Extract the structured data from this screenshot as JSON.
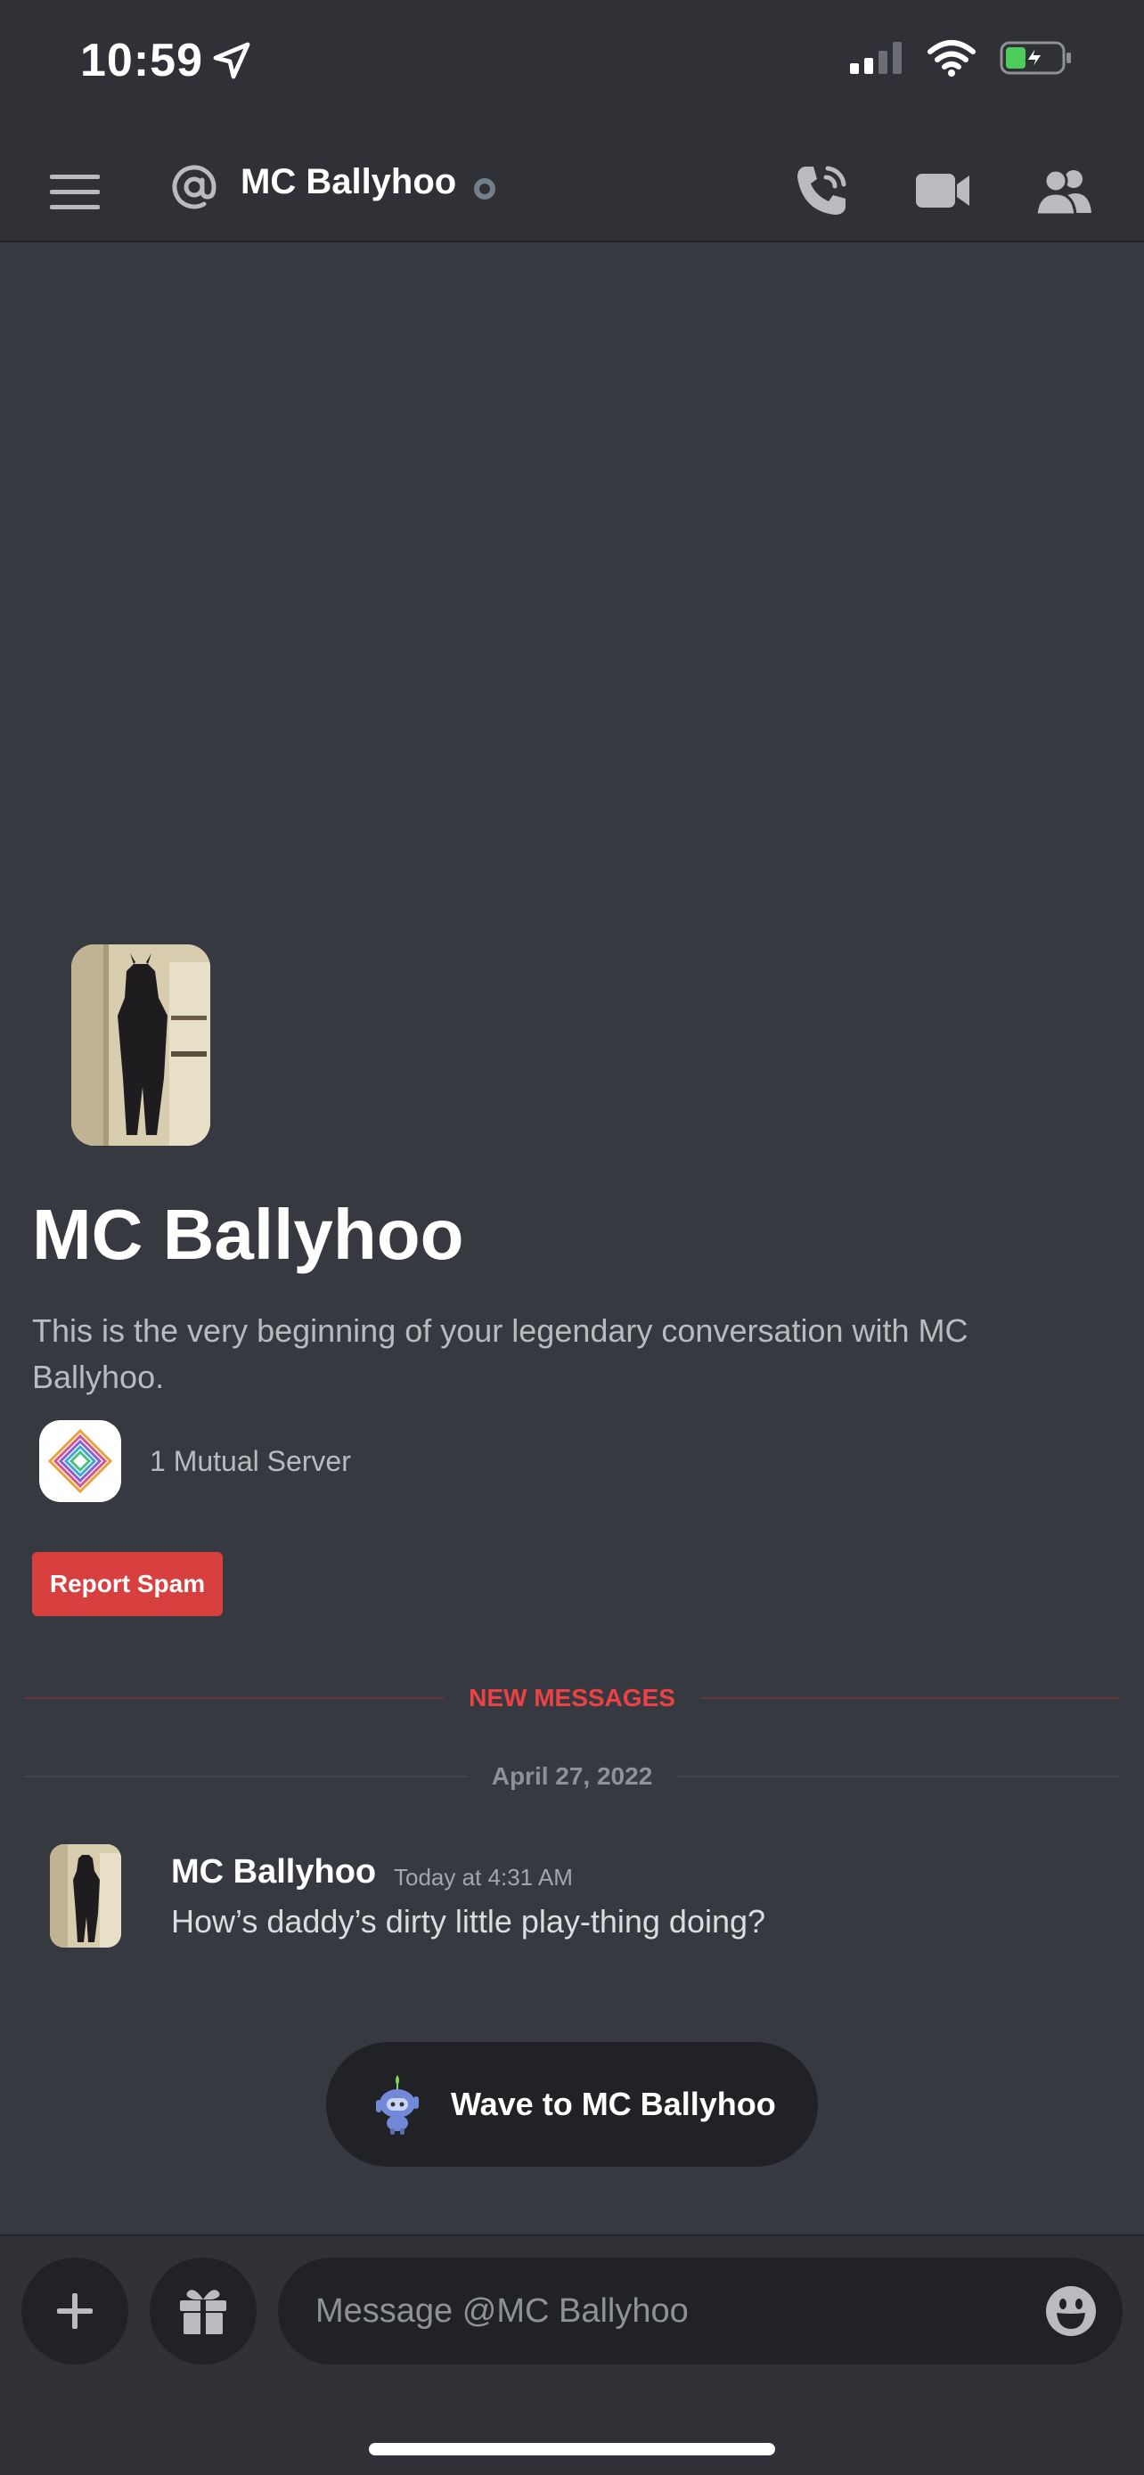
{
  "status_bar": {
    "time": "10:59",
    "icons": [
      "location-arrow-icon",
      "cellular-signal-icon",
      "wifi-icon",
      "battery-charging-icon"
    ]
  },
  "header": {
    "title": "MC Ballyhoo",
    "icons": [
      "hamburger-menu-icon",
      "at-sign-icon",
      "status-offline-dot",
      "phone-call-icon",
      "video-camera-icon",
      "members-icon"
    ]
  },
  "intro": {
    "name": "MC Ballyhoo",
    "description": "This is the very beginning of your legendary conversation with MC Ballyhoo.",
    "mutual_servers": "1 Mutual Server",
    "report_label": "Report Spam"
  },
  "dividers": {
    "new_messages": "NEW MESSAGES",
    "date": "April 27, 2022"
  },
  "message": {
    "author": "MC Ballyhoo",
    "timestamp": "Today at 4:31 AM",
    "text": "How’s daddy’s dirty little play-thing doing?"
  },
  "wave": {
    "label": "Wave to MC Ballyhoo"
  },
  "composer": {
    "placeholder": "Message @MC Ballyhoo"
  },
  "colors": {
    "background": "#36393f",
    "chrome": "#2f3136",
    "input": "#202225",
    "danger": "#d84040",
    "new_messages": "#ed4245"
  }
}
